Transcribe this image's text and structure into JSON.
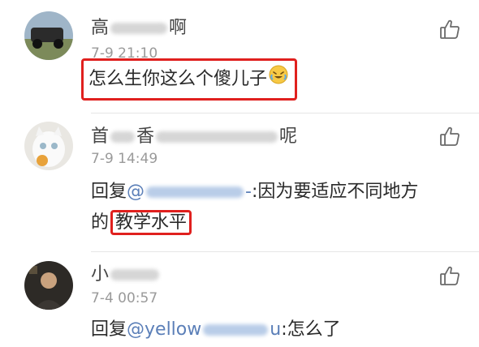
{
  "comments": [
    {
      "name_start": "高",
      "name_end": "啊",
      "time": "7-9 21:10",
      "text": "怎么生你这么个傻儿子",
      "emoji": "laughing-crying-emoji"
    },
    {
      "name_start": "首",
      "name_mid": "香",
      "name_end": "呢",
      "time": "7-9 14:49",
      "reply_prefix": "回复",
      "mention_start": "@",
      "mention_end": "-",
      "text_rest": ":因为要适应不同地方",
      "text_line2_start": "的",
      "text_line2_boxed": "教学水平"
    },
    {
      "name_start": "小",
      "time": "7-4 00:57",
      "reply_prefix": "回复",
      "mention_start": "@",
      "mention_partial": "yellow",
      "mention_end": "u",
      "text_rest": ":怎么了"
    }
  ],
  "colors": {
    "highlight_box": "#e0201e",
    "mention": "#5b7fb8",
    "time": "#9a9a9a"
  },
  "icons": [
    "thumbs-up-icon"
  ]
}
